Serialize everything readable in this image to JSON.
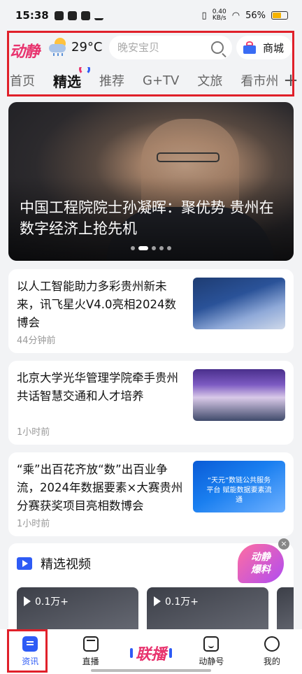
{
  "status_bar": {
    "time": "15:38",
    "net_speed_value": "0.40",
    "net_speed_unit": "KB/s",
    "battery": "56%"
  },
  "header": {
    "brand": "动静",
    "temperature": "29°C",
    "search_placeholder": "晚安宝贝",
    "mall_label": "商城"
  },
  "tabs": [
    "首页",
    "精选",
    "推荐",
    "G+TV",
    "文旅",
    "看市州"
  ],
  "active_tab": "精选",
  "banner": {
    "title": "中国工程院院士孙凝晖：聚优势 贵州在数字经济上抢先机"
  },
  "news": [
    {
      "title": "以人工智能助力多彩贵州新未来，讯飞星火V4.0亮相2024数博会",
      "time": "44分钟前"
    },
    {
      "title": "北京大学光华管理学院牵手贵州共话智慧交通和人才培养",
      "time": "1小时前"
    },
    {
      "title": "“乘”出百花齐放“数”出百业争流，2024年数据要素×大赛贵州分赛获奖项目亮相数博会",
      "time": "1小时前",
      "thumb_text": "“天元”数链公共服务平台 赋能数据要素流通"
    }
  ],
  "video_section": {
    "title": "精选视频",
    "items": [
      {
        "views": "0.1万+"
      },
      {
        "views": "0.1万+"
      }
    ]
  },
  "float_badge": {
    "line1": "动静",
    "line2": "爆料",
    "close": "×"
  },
  "bottom_nav": {
    "news": "资讯",
    "live": "直播",
    "lianbo": "联播",
    "dongjinghao": "动静号",
    "mine": "我的"
  },
  "colors": {
    "accent": "#2e5bf5",
    "brand": "#e8336e",
    "highlight_box": "#e0202a"
  }
}
